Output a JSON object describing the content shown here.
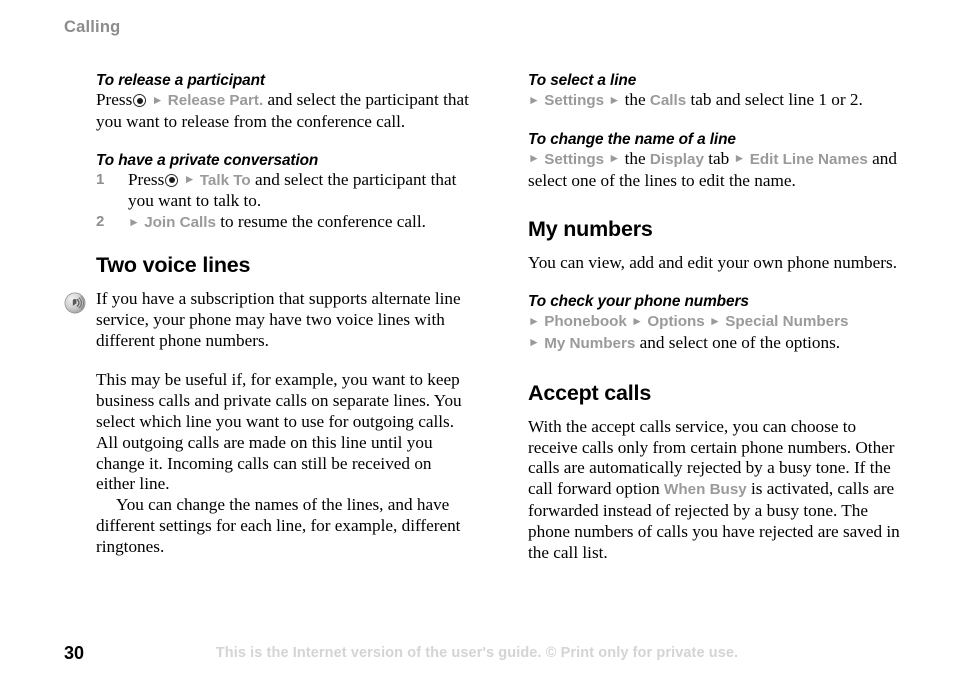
{
  "running_head": "Calling",
  "colors": {
    "ui_label_grey": "#9a9a9a",
    "running_head_grey": "#8c8c8c",
    "footer_grey": "#d4d4d4",
    "step_number_grey": "#8f8f8f",
    "body_text": "#000000"
  },
  "left_column": {
    "task_release": {
      "title": "To release a participant",
      "press_word": "Press",
      "navkey_icon": "navigation-key-icon",
      "arrow": "►",
      "ui_label": "Release Part.",
      "rest": " and select the participant that you want to release from the conference call."
    },
    "task_private": {
      "title": "To have a private conversation",
      "steps": [
        {
          "number": "1",
          "press_word": "Press",
          "navkey_icon": "navigation-key-icon",
          "arrow": "►",
          "ui_label": "Talk To",
          "rest": " and select the participant that you want to talk to."
        },
        {
          "number": "2",
          "arrow": "►",
          "ui_label": "Join Calls",
          "rest": " to resume the conference call."
        }
      ]
    },
    "section_two_voice_lines": {
      "title": "Two voice lines",
      "note_icon": "tip-broadcast-icon",
      "note": "If you have a subscription that supports alternate line service, your phone may have two voice lines with different phone numbers.",
      "paragraph_1": "This may be useful if, for example, you want to keep business calls and private calls on separate lines. You select which line you want to use for outgoing calls. All outgoing calls are made on this line until you change it. Incoming calls can still be received on either line.",
      "paragraph_2": "You can change the names of the lines, and have different settings for each line, for example, different ringtones."
    }
  },
  "right_column": {
    "task_select_line": {
      "title": "To select a line",
      "arrow": "►",
      "ui_label_1": "Settings",
      "mid_1": " the ",
      "ui_label_2": "Calls",
      "rest": " tab and select line 1 or 2."
    },
    "task_change_name": {
      "title": "To change the name of a line",
      "arrow": "►",
      "ui_label_1": "Settings",
      "mid_1": " the ",
      "ui_label_2": "Display",
      "mid_2": " tab ",
      "ui_label_3": "Edit Line Names",
      "rest": "and select one of the lines to edit the name."
    },
    "section_my_numbers": {
      "title": "My numbers",
      "paragraph": "You can view, add and edit your own phone numbers.",
      "task_check": {
        "title": "To check your phone numbers",
        "arrow": "►",
        "ui_label_1": "Phonebook",
        "ui_label_2": "Options",
        "ui_label_3": "Special Numbers",
        "ui_label_4": "My Numbers",
        "rest": " and select one of the options."
      }
    },
    "section_accept_calls": {
      "title": "Accept calls",
      "paragraph_part_1": "With the accept calls service, you can choose to receive calls only from certain phone numbers. Other calls are automatically rejected by a busy tone. If the call forward option ",
      "ui_label": "When Busy",
      "paragraph_part_2": " is activated, calls are forwarded instead of rejected by a busy tone. The phone numbers of calls you have rejected are saved in the call list."
    }
  },
  "footer": {
    "page_number": "30",
    "note": "This is the Internet version of the user's guide. © Print only for private use."
  }
}
